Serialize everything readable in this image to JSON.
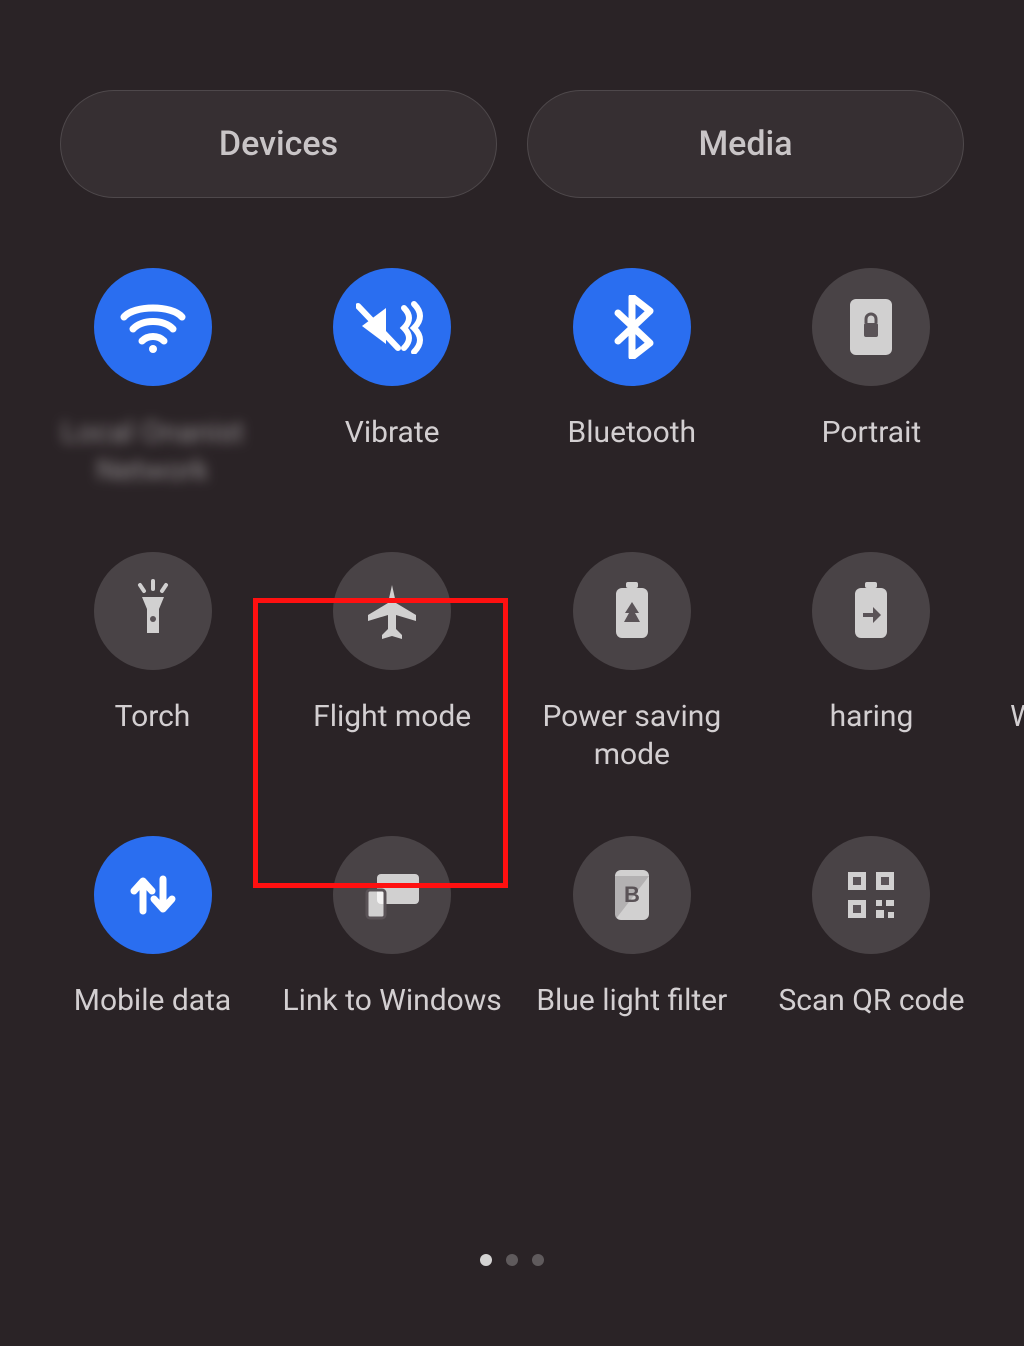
{
  "header": {
    "devices_label": "Devices",
    "media_label": "Media"
  },
  "tiles": {
    "row1": [
      {
        "id": "wifi",
        "label": "Local Onanist Network",
        "active": true,
        "blurred": true
      },
      {
        "id": "vibrate",
        "label": "Vibrate",
        "active": true
      },
      {
        "id": "bluetooth",
        "label": "Bluetooth",
        "active": true
      },
      {
        "id": "portrait",
        "label": "Portrait",
        "active": false
      }
    ],
    "row2": [
      {
        "id": "torch",
        "label": "Torch",
        "active": false
      },
      {
        "id": "flight",
        "label": "Flight mode",
        "active": false,
        "highlighted": true
      },
      {
        "id": "powersaving",
        "label": "Power saving mode",
        "active": false
      },
      {
        "id": "batteryshare",
        "label": "haring",
        "active": false
      }
    ],
    "row2_overflow": "Wi",
    "row3": [
      {
        "id": "mobiledata",
        "label": "Mobile data",
        "active": true
      },
      {
        "id": "linkwindows",
        "label": "Link to Windows",
        "active": false
      },
      {
        "id": "bluelight",
        "label": "Blue light filter",
        "active": false
      },
      {
        "id": "qr",
        "label": "Scan QR code",
        "active": false
      }
    ]
  },
  "colors": {
    "accent": "#2a6ef0",
    "inactive": "rgba(255,255,255,0.15)",
    "highlight": "#ff1010"
  },
  "pagination": {
    "count": 3,
    "active": 0
  }
}
